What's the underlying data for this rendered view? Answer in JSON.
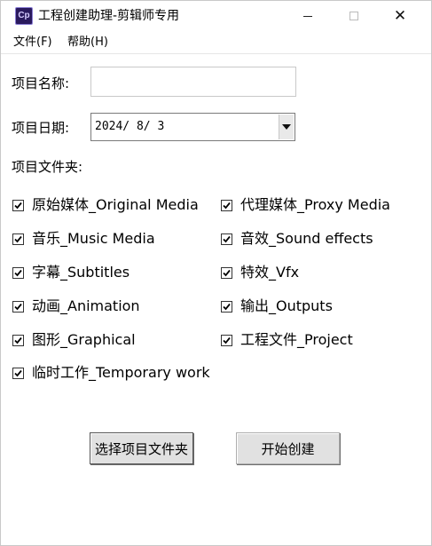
{
  "window": {
    "title": "工程创建助理-剪辑师专用",
    "icon_text": "Cp",
    "controls": {
      "minimize": "minimize-icon",
      "maximize": "maximize-icon",
      "close": "✕"
    }
  },
  "menubar": {
    "file": "文件(F)",
    "help": "帮助(H)"
  },
  "form": {
    "project_name_label": "项目名称:",
    "project_name_value": "",
    "project_date_label": "项目日期:",
    "project_date_value": "2024/ 8/ 3",
    "folders_label": "项目文件夹:"
  },
  "folders": [
    {
      "label": "原始媒体_Original Media",
      "checked": true
    },
    {
      "label": "代理媒体_Proxy Media",
      "checked": true
    },
    {
      "label": "音乐_Music Media",
      "checked": true
    },
    {
      "label": "音效_Sound effects",
      "checked": true
    },
    {
      "label": "字幕_Subtitles",
      "checked": true
    },
    {
      "label": "特效_Vfx",
      "checked": true
    },
    {
      "label": "动画_Animation",
      "checked": true
    },
    {
      "label": "输出_Outputs",
      "checked": true
    },
    {
      "label": "图形_Graphical",
      "checked": true
    },
    {
      "label": "工程文件_Project",
      "checked": true
    },
    {
      "label": "临时工作_Temporary work",
      "checked": true
    }
  ],
  "buttons": {
    "pick_folder": "选择项目文件夹",
    "start_create": "开始创建"
  },
  "colors": {
    "app_icon_bg": "#2a1a5e",
    "button_bg": "#e1e1e1",
    "window_bg": "#ffffff"
  }
}
